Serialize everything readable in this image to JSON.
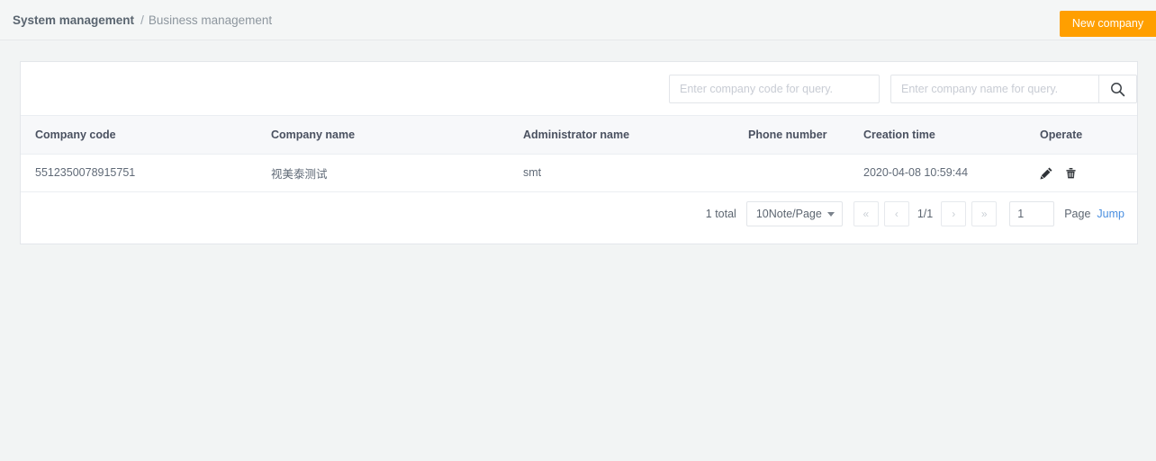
{
  "breadcrumb": {
    "parent": "System management",
    "separator": "/",
    "current": "Business management"
  },
  "header": {
    "new_company_label": "New company",
    "accent_color": "#ff9f00"
  },
  "search": {
    "code_placeholder": "Enter company code for query.",
    "name_placeholder": "Enter company name for query.",
    "code_value": "",
    "name_value": "",
    "search_icon": "search-icon"
  },
  "table": {
    "columns": [
      "Company code",
      "Company name",
      "Administrator name",
      "Phone number",
      "Creation time",
      "Operate"
    ],
    "rows": [
      {
        "company_code": "5512350078915751",
        "company_name": "视美泰测试",
        "administrator_name": "smt",
        "phone_number": "",
        "creation_time": "2020-04-08 10:59:44",
        "operations": [
          "edit-icon",
          "delete-icon"
        ]
      }
    ]
  },
  "pagination": {
    "total_label": "1 total",
    "page_size_label": "10Note/Page",
    "first_label": "«",
    "prev_label": "‹",
    "current_label": "1/1",
    "next_label": "›",
    "last_label": "»",
    "jump_value": "1",
    "page_word": "Page",
    "jump_label": "Jump",
    "link_color": "#4a8fe0"
  }
}
